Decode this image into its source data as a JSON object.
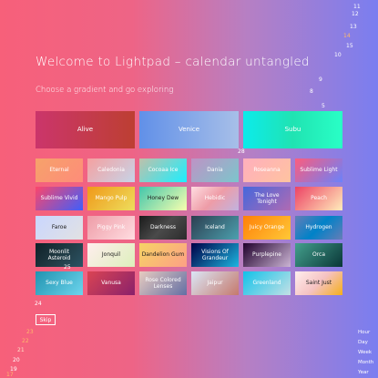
{
  "header": {
    "title": "Welcome to Lightpad – calendar untangled",
    "subtitle": "Choose a gradient and go exploring"
  },
  "featured": [
    {
      "label": "Alive",
      "bg": "linear-gradient(90deg,#cb356b,#bd3f32)"
    },
    {
      "label": "Venice",
      "bg": "linear-gradient(90deg,#6190e8,#a7bfe8)"
    },
    {
      "label": "Subu",
      "bg": "linear-gradient(90deg,#0cebeb,#20e3b2,#29ffc6)"
    }
  ],
  "gradients": [
    {
      "label": "Eternal",
      "bg": "linear-gradient(135deg,#f6a26a,#fe8c7a)",
      "dark": false
    },
    {
      "label": "Caledonia",
      "bg": "linear-gradient(135deg,#f5a0a0,#c6d4e8)",
      "dark": false
    },
    {
      "label": "Cocoaa Ice",
      "bg": "linear-gradient(135deg,#c0c0aa,#1cefff)",
      "dark": false
    },
    {
      "label": "Dania",
      "bg": "linear-gradient(135deg,#be93c5,#7bc6cc)",
      "dark": false
    },
    {
      "label": "Roseanna",
      "bg": "linear-gradient(135deg,#ffafbd,#ffc3a0)",
      "dark": false
    },
    {
      "label": "Sublime Light",
      "bg": "linear-gradient(135deg,#fc5c7d,#6a82fb)",
      "dark": false
    },
    {
      "label": "Sublime Vivid",
      "bg": "linear-gradient(135deg,#fc466b,#3f5efb)",
      "dark": false
    },
    {
      "label": "Mango Pulp",
      "bg": "linear-gradient(135deg,#f09819,#edde5d)",
      "dark": false
    },
    {
      "label": "Honey Dew",
      "bg": "linear-gradient(135deg,#43c6ac,#f8ffae)",
      "dark": true
    },
    {
      "label": "Hebidic",
      "bg": "linear-gradient(135deg,#ffdde1,#ee9ca7,#c0b3e0)",
      "dark": false
    },
    {
      "label": "The Love Tonight",
      "bg": "linear-gradient(135deg,#4568dc,#b06ab3)",
      "dark": false
    },
    {
      "label": "Peach",
      "bg": "linear-gradient(135deg,#ed4264,#ffedbc)",
      "dark": false
    },
    {
      "label": "Faroe",
      "bg": "linear-gradient(135deg,#c9d6ff,#e2e2e2)",
      "dark": true
    },
    {
      "label": "Piggy Pink",
      "bg": "linear-gradient(135deg,#ee9ca7,#ffdde1)",
      "dark": false
    },
    {
      "label": "Darkness",
      "bg": "linear-gradient(135deg,#1a1a1a,#4a4a4a,#2b2b2b)",
      "dark": false
    },
    {
      "label": "Iceland",
      "bg": "linear-gradient(135deg,#2c3e50,#4ca1af)",
      "dark": false
    },
    {
      "label": "Juicy Orange",
      "bg": "linear-gradient(135deg,#ff8008,#ffc837)",
      "dark": false
    },
    {
      "label": "Hydrogen",
      "bg": "linear-gradient(135deg,#667db6,#0082c8,#667db6)",
      "dark": false
    },
    {
      "label": "Moonlit Asteroid",
      "bg": "linear-gradient(135deg,#0f2027,#203a43,#2c5364)",
      "dark": false
    },
    {
      "label": "Jonquil",
      "bg": "linear-gradient(135deg,#ffeeee,#ddefbb)",
      "dark": true
    },
    {
      "label": "Dandelion Gum",
      "bg": "linear-gradient(135deg,#f6d365,#fda085)",
      "dark": true
    },
    {
      "label": "Visions Of Grandeur",
      "bg": "linear-gradient(135deg,#000046,#1cb5e0)",
      "dark": false
    },
    {
      "label": "Purplepine",
      "bg": "linear-gradient(135deg,#20002c,#cbb4d4)",
      "dark": false
    },
    {
      "label": "Orca",
      "bg": "linear-gradient(135deg,#44a08d,#093637)",
      "dark": false
    },
    {
      "label": "Sexy Blue",
      "bg": "linear-gradient(135deg,#2193b0,#6dd5ed)",
      "dark": false
    },
    {
      "label": "Vanusa",
      "bg": "linear-gradient(135deg,#da4453,#89216b)",
      "dark": false
    },
    {
      "label": "Rose Colored Lenses",
      "bg": "linear-gradient(135deg,#e8cbc0,#636fa4)",
      "dark": false
    },
    {
      "label": "Jaipur",
      "bg": "linear-gradient(135deg,#dbe6f6,#c5796d)",
      "dark": false
    },
    {
      "label": "Greenland",
      "bg": "linear-gradient(135deg,#12c2e9,#c4e0e5)",
      "dark": false
    },
    {
      "label": "Saint Just",
      "bg": "linear-gradient(135deg,#ffeeee,#f5c2c2,#f5af19)",
      "dark": true
    }
  ],
  "day_markers": [
    {
      "text": "11"
    },
    {
      "text": "12"
    },
    {
      "text": "13"
    },
    {
      "text": "14"
    },
    {
      "text": "15"
    },
    {
      "text": "10"
    },
    {
      "text": "9"
    },
    {
      "text": "8"
    },
    {
      "text": "5"
    },
    {
      "text": "28"
    },
    {
      "text": "25"
    },
    {
      "text": "24"
    },
    {
      "text": "23"
    },
    {
      "text": "22"
    },
    {
      "text": "21"
    },
    {
      "text": "20"
    },
    {
      "text": "19"
    },
    {
      "text": "17"
    }
  ],
  "skip_label": "Skip",
  "views": [
    "Hour",
    "Day",
    "Week",
    "Month",
    "Year"
  ]
}
